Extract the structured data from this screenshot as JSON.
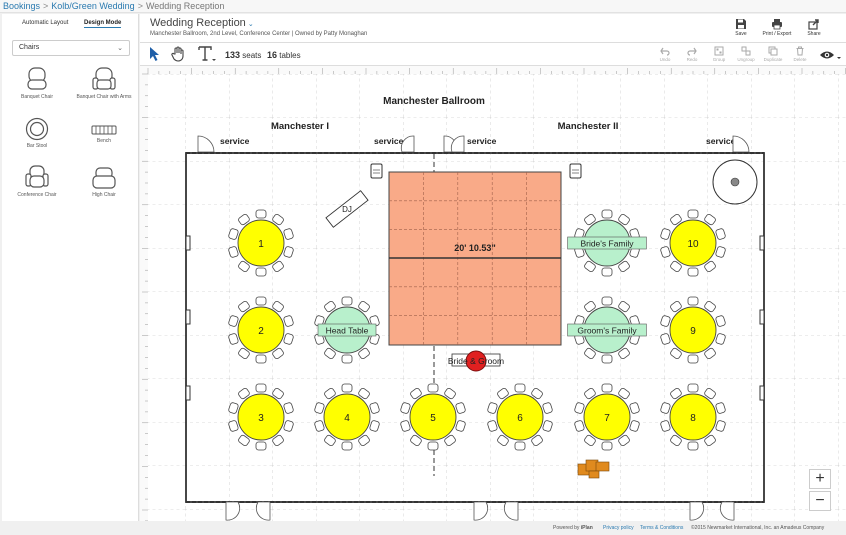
{
  "breadcrumb": {
    "items": [
      "Bookings",
      "Kolb/Green Wedding"
    ],
    "current": "Wedding Reception"
  },
  "left_panel": {
    "tabs": [
      "Automatic Layout",
      "Design Mode"
    ],
    "category": "Chairs",
    "chairs": [
      "Banquet Chair",
      "Banquet Chair with Arms",
      "Bar Stool",
      "Bench",
      "Conference Chair",
      "High Chair"
    ]
  },
  "header": {
    "title": "Wedding Reception",
    "subtitle": "Manchester Ballroom, 2nd Level, Conference Center  |  Owned by Patty Monaghan",
    "buttons": [
      "Save",
      "Print / Export",
      "Share"
    ]
  },
  "toolbar": {
    "seats_count": "133",
    "seats_label": "seats",
    "tables_count": "16",
    "tables_label": "tables",
    "edit_actions": [
      "Undo",
      "Redo",
      "Group",
      "Ungroup",
      "Duplicate",
      "Delete"
    ]
  },
  "floorplan": {
    "room_name": "Manchester Ballroom",
    "section_left": "Manchester I",
    "section_right": "Manchester II",
    "service_labels": [
      "service",
      "service",
      "service",
      "service"
    ],
    "dj_label": "DJ",
    "dance_floor_label": "20' 10.53\"",
    "couple_label": "Bride & Groom",
    "tables": [
      {
        "label": "1",
        "color": "#ffff00"
      },
      {
        "label": "2",
        "color": "#ffff00"
      },
      {
        "label": "3",
        "color": "#ffff00"
      },
      {
        "label": "4",
        "color": "#ffff00"
      },
      {
        "label": "5",
        "color": "#ffff00"
      },
      {
        "label": "6",
        "color": "#ffff00"
      },
      {
        "label": "7",
        "color": "#ffff00"
      },
      {
        "label": "8",
        "color": "#ffff00"
      },
      {
        "label": "9",
        "color": "#ffff00"
      },
      {
        "label": "10",
        "color": "#ffff00"
      },
      {
        "label": "Head Table",
        "color": "#b8f0cc"
      },
      {
        "label": "Bride's Family",
        "color": "#b8f0cc"
      },
      {
        "label": "Groom's Family",
        "color": "#b8f0cc"
      }
    ],
    "colors": {
      "dance_floor": "#f9aa88",
      "couple_table": "#e02020",
      "accent": "#2a7ab0"
    }
  },
  "zoom": {
    "in": "+",
    "out": "−"
  },
  "footer": {
    "powered_by": "Powered by",
    "brand": "iPlan",
    "links": [
      "Privacy policy",
      "Terms & Conditions"
    ],
    "copyright": "©2015 Newmarket International, Inc. an Amadeus Company"
  }
}
